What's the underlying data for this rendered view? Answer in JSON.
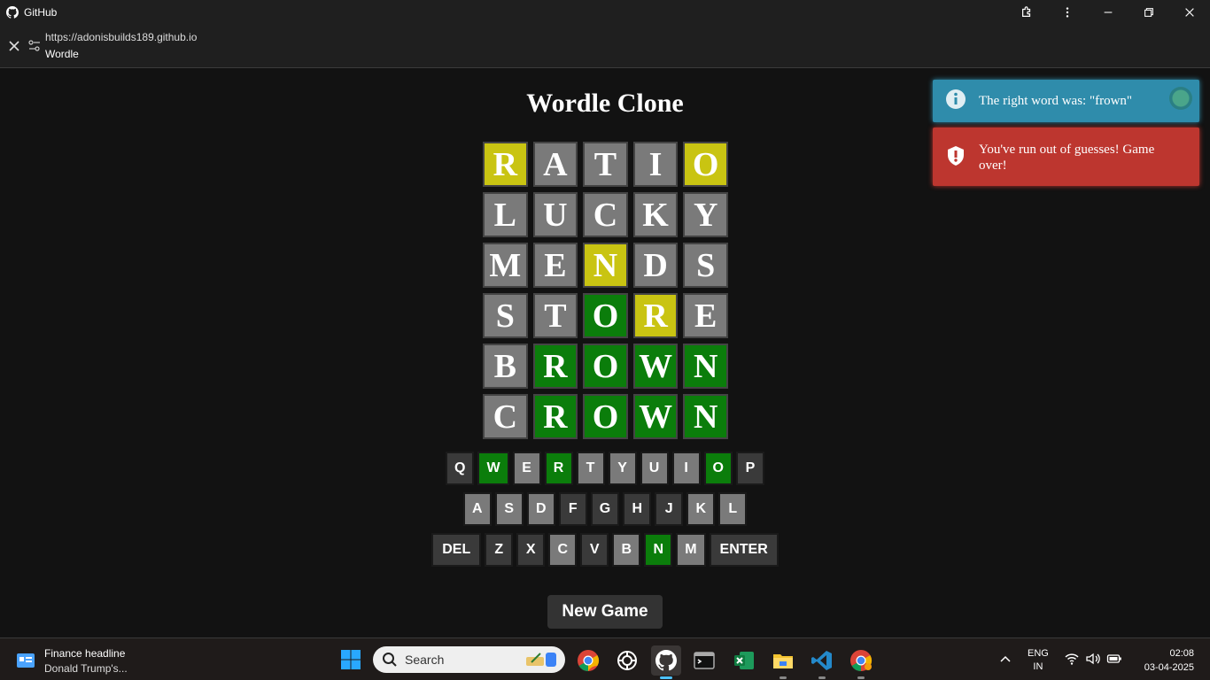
{
  "titlebar": {
    "app_name": "GitHub"
  },
  "urlbar": {
    "url": "https://adonisbuilds189.github.io",
    "page_title": "Wordle"
  },
  "game": {
    "title": "Wordle Clone",
    "board": [
      [
        {
          "l": "R",
          "s": "yellow"
        },
        {
          "l": "A",
          "s": "gray"
        },
        {
          "l": "T",
          "s": "gray"
        },
        {
          "l": "I",
          "s": "gray"
        },
        {
          "l": "O",
          "s": "yellow"
        }
      ],
      [
        {
          "l": "L",
          "s": "gray"
        },
        {
          "l": "U",
          "s": "gray"
        },
        {
          "l": "C",
          "s": "gray"
        },
        {
          "l": "K",
          "s": "gray"
        },
        {
          "l": "Y",
          "s": "gray"
        }
      ],
      [
        {
          "l": "M",
          "s": "gray"
        },
        {
          "l": "E",
          "s": "gray"
        },
        {
          "l": "N",
          "s": "yellow"
        },
        {
          "l": "D",
          "s": "gray"
        },
        {
          "l": "S",
          "s": "gray"
        }
      ],
      [
        {
          "l": "S",
          "s": "gray"
        },
        {
          "l": "T",
          "s": "gray"
        },
        {
          "l": "O",
          "s": "green"
        },
        {
          "l": "R",
          "s": "yellow"
        },
        {
          "l": "E",
          "s": "gray"
        }
      ],
      [
        {
          "l": "B",
          "s": "gray"
        },
        {
          "l": "R",
          "s": "green"
        },
        {
          "l": "O",
          "s": "green"
        },
        {
          "l": "W",
          "s": "green"
        },
        {
          "l": "N",
          "s": "green"
        }
      ],
      [
        {
          "l": "C",
          "s": "gray"
        },
        {
          "l": "R",
          "s": "green"
        },
        {
          "l": "O",
          "s": "green"
        },
        {
          "l": "W",
          "s": "green"
        },
        {
          "l": "N",
          "s": "green"
        }
      ]
    ],
    "keyboard": [
      [
        {
          "k": "Q",
          "s": "unused"
        },
        {
          "k": "W",
          "s": "correct"
        },
        {
          "k": "E",
          "s": "absent"
        },
        {
          "k": "R",
          "s": "correct"
        },
        {
          "k": "T",
          "s": "absent"
        },
        {
          "k": "Y",
          "s": "absent"
        },
        {
          "k": "U",
          "s": "absent"
        },
        {
          "k": "I",
          "s": "absent"
        },
        {
          "k": "O",
          "s": "correct"
        },
        {
          "k": "P",
          "s": "unused"
        }
      ],
      [
        {
          "k": "A",
          "s": "absent"
        },
        {
          "k": "S",
          "s": "absent"
        },
        {
          "k": "D",
          "s": "absent"
        },
        {
          "k": "F",
          "s": "unused"
        },
        {
          "k": "G",
          "s": "unused"
        },
        {
          "k": "H",
          "s": "unused"
        },
        {
          "k": "J",
          "s": "unused"
        },
        {
          "k": "K",
          "s": "absent"
        },
        {
          "k": "L",
          "s": "absent"
        }
      ],
      [
        {
          "k": "DEL",
          "s": "unused"
        },
        {
          "k": "Z",
          "s": "unused"
        },
        {
          "k": "X",
          "s": "unused"
        },
        {
          "k": "C",
          "s": "absent"
        },
        {
          "k": "V",
          "s": "unused"
        },
        {
          "k": "B",
          "s": "absent"
        },
        {
          "k": "N",
          "s": "correct"
        },
        {
          "k": "M",
          "s": "absent"
        },
        {
          "k": "ENTER",
          "s": "unused"
        }
      ]
    ],
    "new_game_label": "New Game"
  },
  "toasts": {
    "info": "The right word was: \"frown\"",
    "error": "You've run out of guesses! Game over!"
  },
  "taskbar": {
    "news_headline": "Finance headline",
    "news_sub": "Donald Trump's...",
    "search_placeholder": "Search",
    "apps": [
      "chrome-icon",
      "chatgpt-icon",
      "github-icon",
      "terminal-icon",
      "excel-icon",
      "file-explorer-icon",
      "vscode-icon",
      "chrome-profile-icon"
    ],
    "lang_top": "ENG",
    "lang_bottom": "IN",
    "time": "02:08",
    "date": "03-04-2025"
  },
  "colors": {
    "gray": "#7a7a7a",
    "yellow": "#c9c412",
    "green": "#0b7d0b",
    "info": "#2f8cab",
    "error": "#bd362f"
  }
}
